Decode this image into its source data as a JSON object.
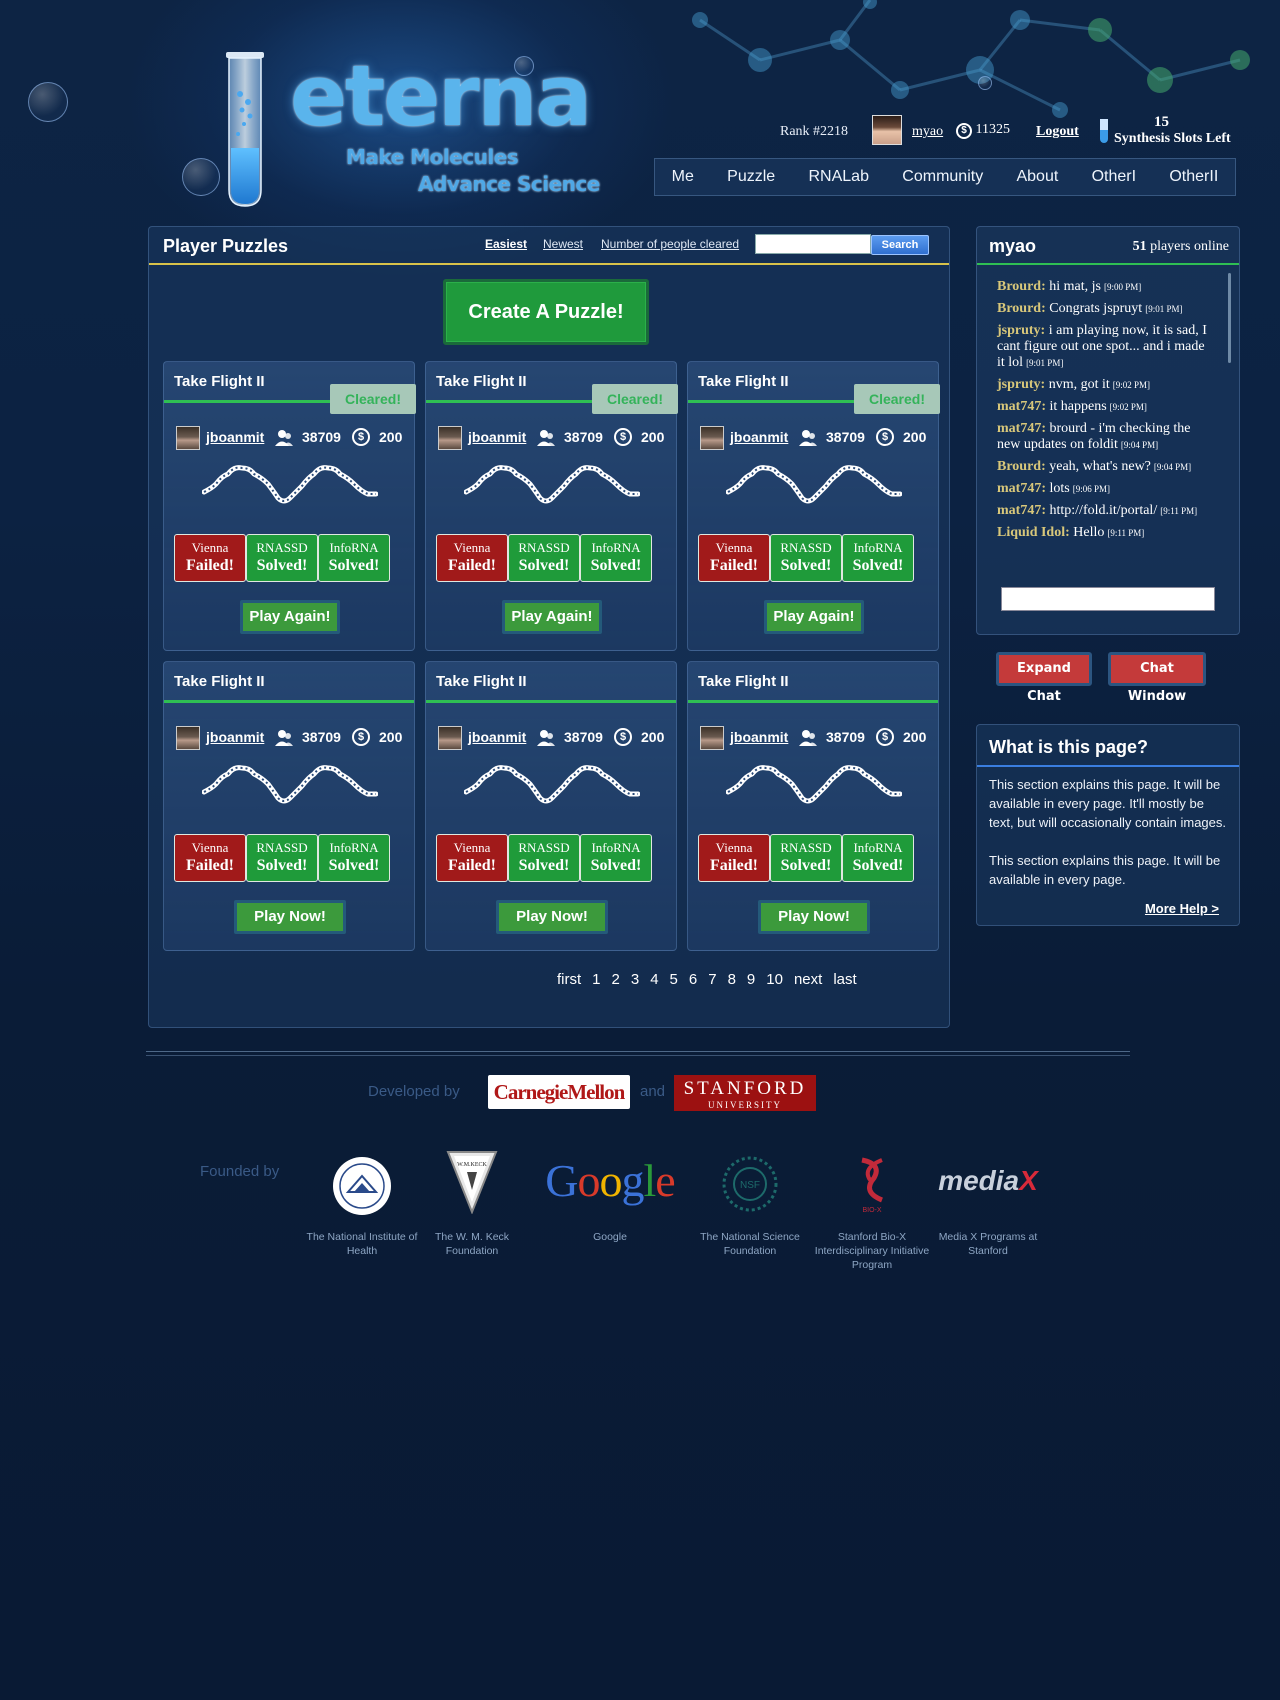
{
  "brand": {
    "wordmark": "eterna",
    "tagline_1": "Make Molecules",
    "tagline_2": "Advance Science"
  },
  "user_bar": {
    "rank": "Rank #2218",
    "username": "myao",
    "coins": "11325",
    "logout": "Logout",
    "slots_count": "15",
    "slots_label": "Synthesis Slots Left"
  },
  "nav": {
    "items": [
      "Me",
      "Puzzle",
      "RNALab",
      "Community",
      "About",
      "OtherI",
      "OtherII"
    ]
  },
  "puzzles": {
    "title": "Player Puzzles",
    "sorts": [
      "Easiest",
      "Newest",
      "Number of people cleared"
    ],
    "search_button": "Search",
    "search_value": "",
    "create_button": "Create A Puzzle!",
    "cards": [
      {
        "title": "Take Flight II",
        "cleared": "Cleared!",
        "author": "jboanmit",
        "people": "38709",
        "reward": "200",
        "play": "Play Again!"
      },
      {
        "title": "Take Flight II",
        "cleared": "Cleared!",
        "author": "jboanmit",
        "people": "38709",
        "reward": "200",
        "play": "Play Again!"
      },
      {
        "title": "Take Flight II",
        "cleared": "Cleared!",
        "author": "jboanmit",
        "people": "38709",
        "reward": "200",
        "play": "Play Again!"
      },
      {
        "title": "Take Flight II",
        "cleared": "",
        "author": "jboanmit",
        "people": "38709",
        "reward": "200",
        "play": "Play Now!"
      },
      {
        "title": "Take Flight II",
        "cleared": "",
        "author": "jboanmit",
        "people": "38709",
        "reward": "200",
        "play": "Play Now!"
      },
      {
        "title": "Take Flight II",
        "cleared": "",
        "author": "jboanmit",
        "people": "38709",
        "reward": "200",
        "play": "Play Now!"
      }
    ],
    "results": [
      {
        "engine": "Vienna",
        "status": "Failed!",
        "color": "#a11a1a"
      },
      {
        "engine": "RNASSD",
        "status": "Solved!",
        "color": "#1f9b3a"
      },
      {
        "engine": "InfoRNA",
        "status": "Solved!",
        "color": "#1f9b3a"
      }
    ],
    "pager": [
      "first",
      "1",
      "2",
      "3",
      "4",
      "5",
      "6",
      "7",
      "8",
      "9",
      "10",
      "next",
      "last"
    ]
  },
  "chat": {
    "user": "myao",
    "online_count": "51",
    "online_label": "players online",
    "messages": [
      {
        "who": "Brourd:",
        "text": "hi mat, js",
        "time": "[9:00 PM]"
      },
      {
        "who": "Brourd:",
        "text": "Congrats jspruyt",
        "time": "[9:01 PM]"
      },
      {
        "who": "jspruty:",
        "text": "i am playing now, it is sad, I cant figure out one spot... and i made it lol",
        "time": "[9:01 PM]"
      },
      {
        "who": "jspruty:",
        "text": "nvm, got it",
        "time": "[9:02 PM]"
      },
      {
        "who": "mat747:",
        "text": "it happens",
        "time": "[9:02 PM]"
      },
      {
        "who": "mat747:",
        "text": "brourd - i'm checking the new updates on foldit",
        "time": "[9:04 PM]"
      },
      {
        "who": "Brourd:",
        "text": "yeah, what's new?",
        "time": "[9:04 PM]"
      },
      {
        "who": "mat747:",
        "text": "lots",
        "time": "[9:06 PM]"
      },
      {
        "who": "mat747:",
        "text": "http://fold.it/portal/",
        "time": "[9:11 PM]"
      },
      {
        "who": "Liquid Idol:",
        "text": "Hello",
        "time": "[9:11 PM]"
      }
    ],
    "expand": "Expand Chat",
    "window": "Chat Window"
  },
  "help": {
    "title": "What is this page?",
    "p1": "This section explains this page. It will be available in every page. It'll mostly be text, but will occasionally contain images.",
    "p2": "This section explains this page. It will be available in every page.",
    "more": "More Help >"
  },
  "footer": {
    "developed_by": "Developed by",
    "cmu": "CarnegieMellon",
    "and": "and",
    "stanford": "STANFORD",
    "stanford_sub": "UNIVERSITY",
    "founded_by": "Founded by",
    "sponsors": [
      {
        "label": "The National Institute of Health",
        "icon": "nih-seal-icon"
      },
      {
        "label": "The W. M. Keck Foundation",
        "icon": "keck-logo-icon"
      },
      {
        "label": "Google",
        "icon": "google-logo"
      },
      {
        "label": "The National Science Foundation",
        "icon": "nsf-seal-icon"
      },
      {
        "label": "Stanford Bio-X Interdisciplinary Initiative Program",
        "icon": "biox-logo-icon"
      },
      {
        "label": "Media X Programs at Stanford",
        "icon": "mediax-logo"
      }
    ],
    "google_word": "Google",
    "mediax_word": "mediaX",
    "keck_text": "W.M.KECK",
    "biox_text": "BIO-X"
  },
  "colors": {
    "cleared_green": "#2fbf53",
    "failed_red": "#a11a1a",
    "solved_green": "#1f9b3a",
    "brand_blue": "#5ab4ec"
  }
}
